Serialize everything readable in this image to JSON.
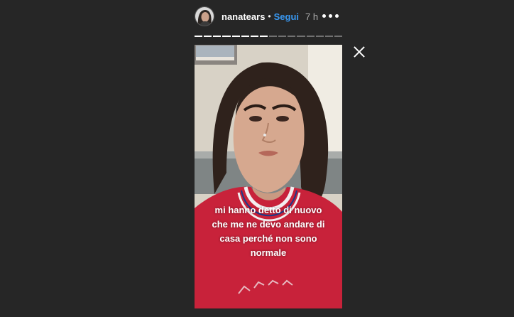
{
  "header": {
    "username": "nanatears",
    "separator": "•",
    "follow_label": "Segui",
    "time": "7 h"
  },
  "progress": {
    "segment_count": 16,
    "completed_segments": 8
  },
  "story": {
    "caption_lines": [
      "mi hanno detto di nuovo",
      "che me ne devo andare di",
      "casa perché non sono",
      "normale"
    ]
  },
  "icons": {
    "more": "more-options-icon",
    "close": "close-icon"
  },
  "colors": {
    "background": "#262626",
    "accent": "#3897f0",
    "sweater": "#c8223a"
  }
}
